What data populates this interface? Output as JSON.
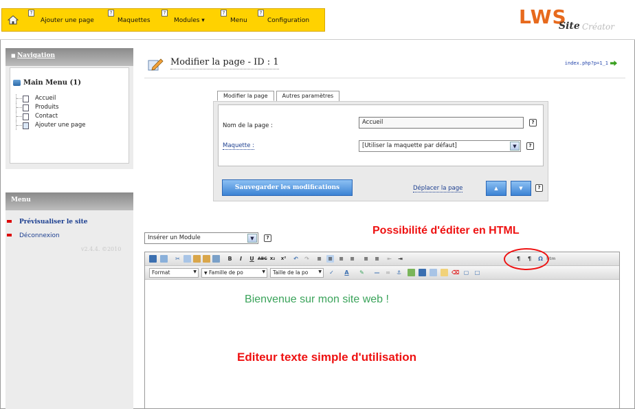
{
  "topnav": {
    "items": [
      {
        "label": "Ajouter une page",
        "help": "?"
      },
      {
        "label": "Maquettes",
        "help": "?"
      },
      {
        "label": "Modules ▾",
        "help": "?"
      },
      {
        "label": "Menu",
        "help": "?"
      },
      {
        "label": "Configuration",
        "help": "?"
      }
    ]
  },
  "logo": {
    "lws": "LWS",
    "site": "Site",
    "creator": "Créator"
  },
  "sidebar": {
    "navigation_label": "Navigation",
    "main_menu_title": "Main Menu (1)",
    "pages": [
      "Accueil",
      "Produits",
      "Contact",
      "Ajouter une page"
    ],
    "menu_label": "Menu",
    "menu_items": [
      "Prévisualiser le site",
      "Déconnexion"
    ],
    "version": "v2.4.4. ©2010"
  },
  "main": {
    "title": "Modifier la page - ID : 1",
    "url": "index.php?p=1_1"
  },
  "form": {
    "tabs": [
      "Modifier la page",
      "Autres paramètres"
    ],
    "name_label": "Nom de la page :",
    "name_value": "Accueil",
    "maquette_label": "Maquette :",
    "maquette_value": "[Utiliser la maquette par défaut]",
    "save_label": "Sauvegarder les modifications",
    "move_label": "Déplacer la page",
    "up_label": "▲",
    "down_label": "▼",
    "help": "?"
  },
  "module": {
    "placeholder": "Insérer un Module"
  },
  "editor": {
    "format_label": "Format",
    "font_family_label": "Famille de po",
    "font_size_label": "Taille de la po",
    "content": "Bienvenue sur mon site web !"
  },
  "annotations": {
    "html": "Possibilité d'éditer en HTML",
    "simple": "Editeur texte simple d'utilisation"
  },
  "colors": {
    "accent_yellow": "#ffd200",
    "brand_orange": "#e76a1d",
    "annotation_red": "#e11111",
    "welcome_green": "#3aa35a"
  }
}
